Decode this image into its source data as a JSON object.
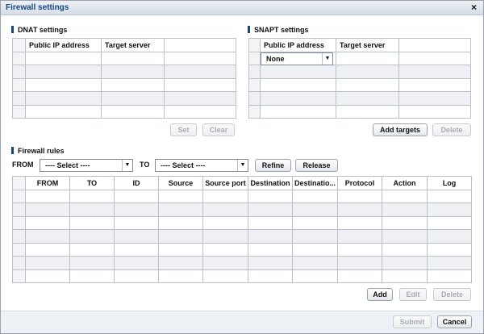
{
  "dialog": {
    "title": "Firewall settings",
    "close_glyph": "×"
  },
  "dnat": {
    "title": "DNAT settings",
    "columns": [
      "Public IP address",
      "Target server",
      ""
    ],
    "row_count": 5,
    "set_label": "Set",
    "clear_label": "Clear"
  },
  "snapt": {
    "title": "SNAPT settings",
    "columns": [
      "Public IP address",
      "Target server",
      ""
    ],
    "first_row_select": "None",
    "row_count": 5,
    "add_targets_label": "Add targets",
    "delete_label": "Delete"
  },
  "rules": {
    "title": "Firewall rules",
    "from_label": "FROM",
    "from_select": "---- Select ----",
    "to_label": "TO",
    "to_select": "---- Select ----",
    "refine_label": "Refine",
    "release_label": "Release",
    "columns": [
      "FROM",
      "TO",
      "ID",
      "Source",
      "Source port",
      "Destination",
      "Destinatio...",
      "Protocol",
      "Action",
      "Log"
    ],
    "row_count": 7,
    "add_label": "Add",
    "edit_label": "Edit",
    "delete_label": "Delete"
  },
  "footer": {
    "submit_label": "Submit",
    "cancel_label": "Cancel"
  },
  "colors": {
    "title_text": "#16487f",
    "section_bar": "#15467b",
    "row_alt": "#eef0f3"
  }
}
